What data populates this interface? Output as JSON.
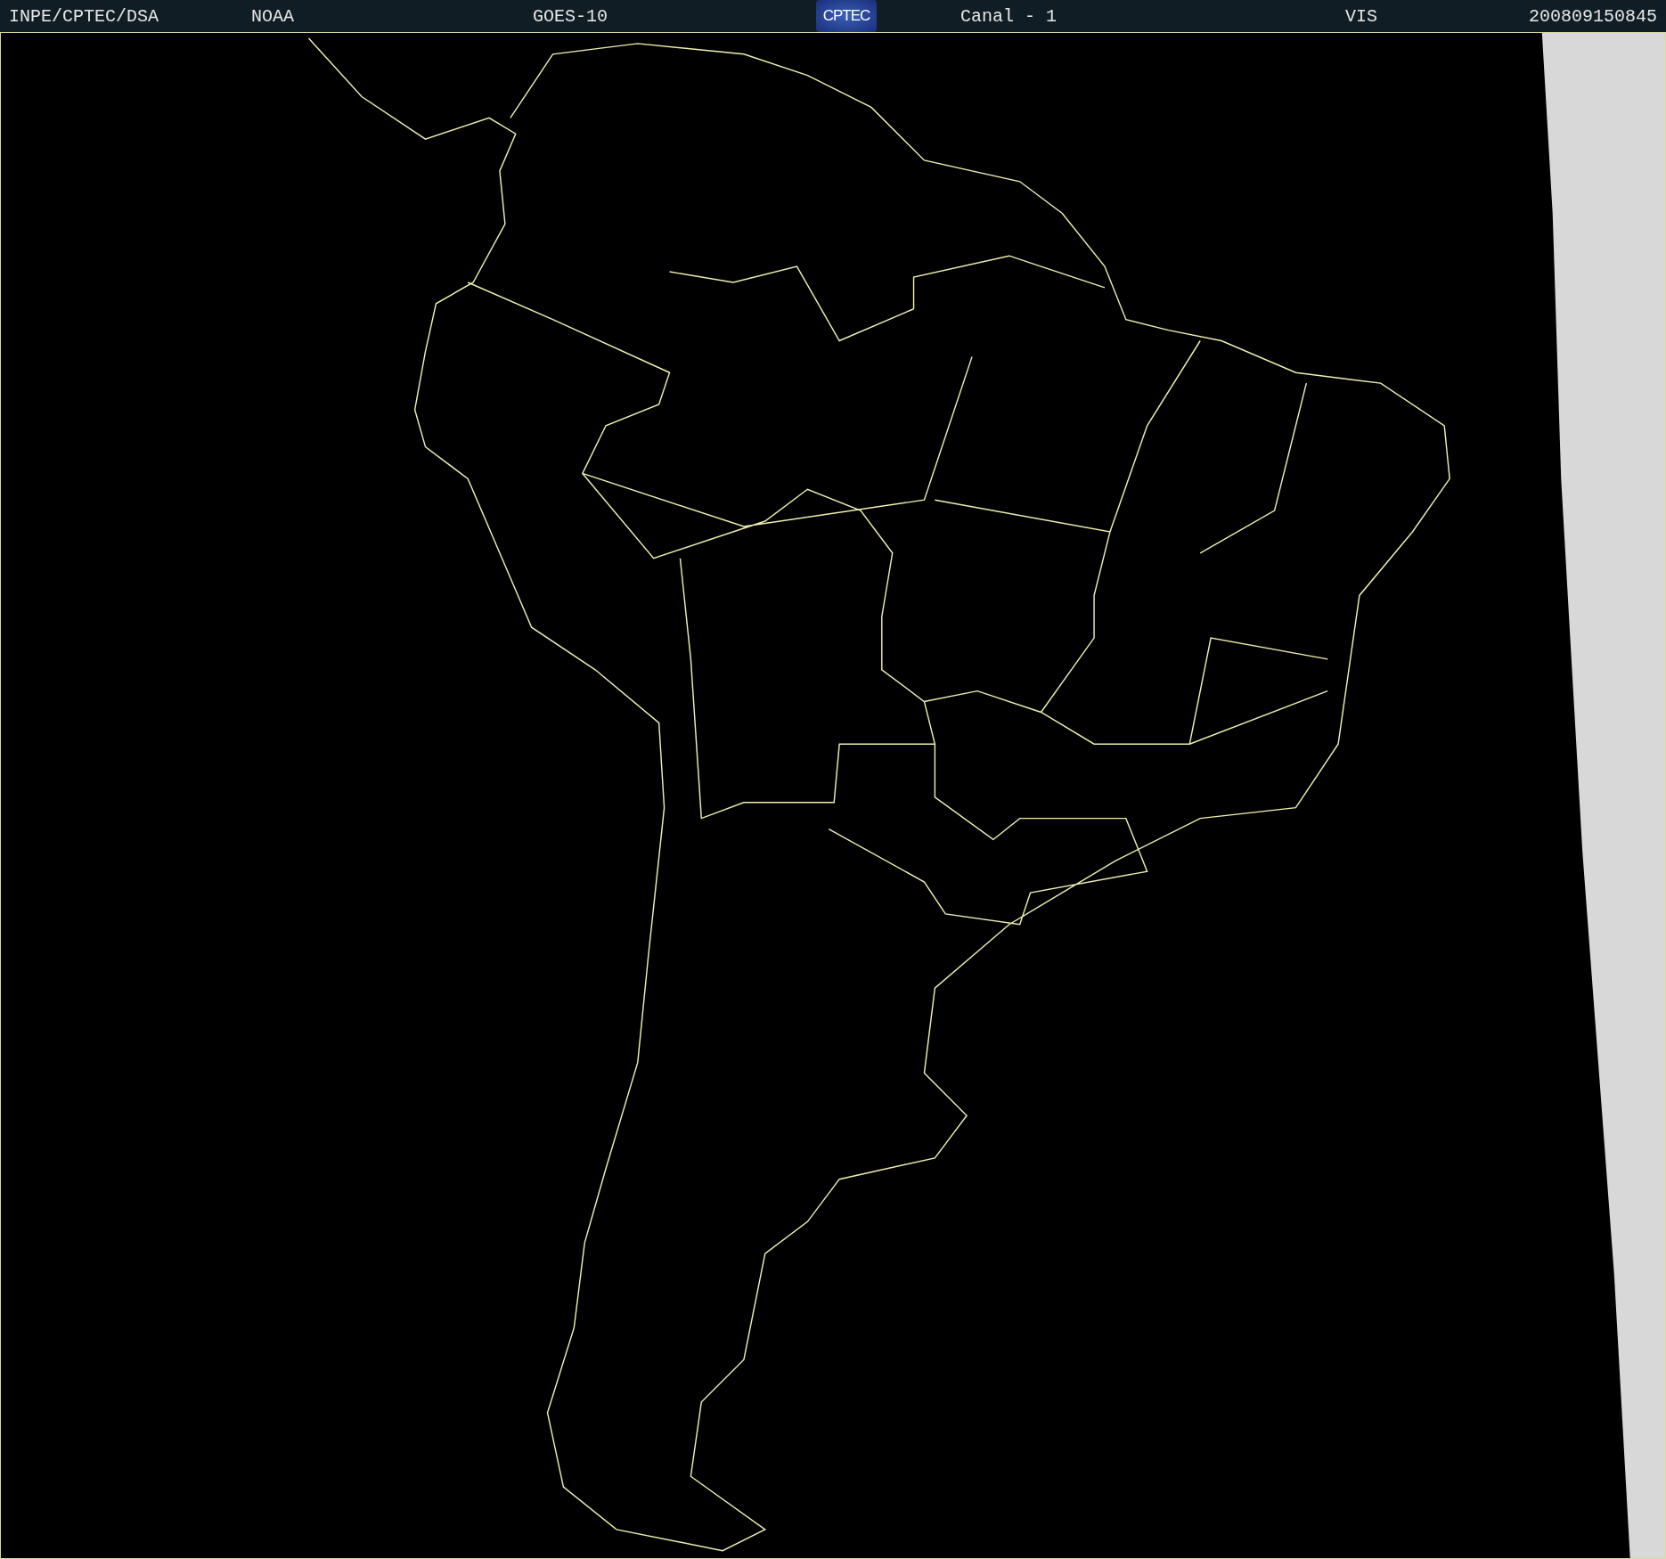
{
  "header": {
    "source": "INPE/CPTEC/DSA",
    "agency": "NOAA",
    "satellite": "GOES-10",
    "logo_text": "CPTEC",
    "channel": "Canal - 1",
    "band": "VIS",
    "timestamp": "200809150845"
  }
}
